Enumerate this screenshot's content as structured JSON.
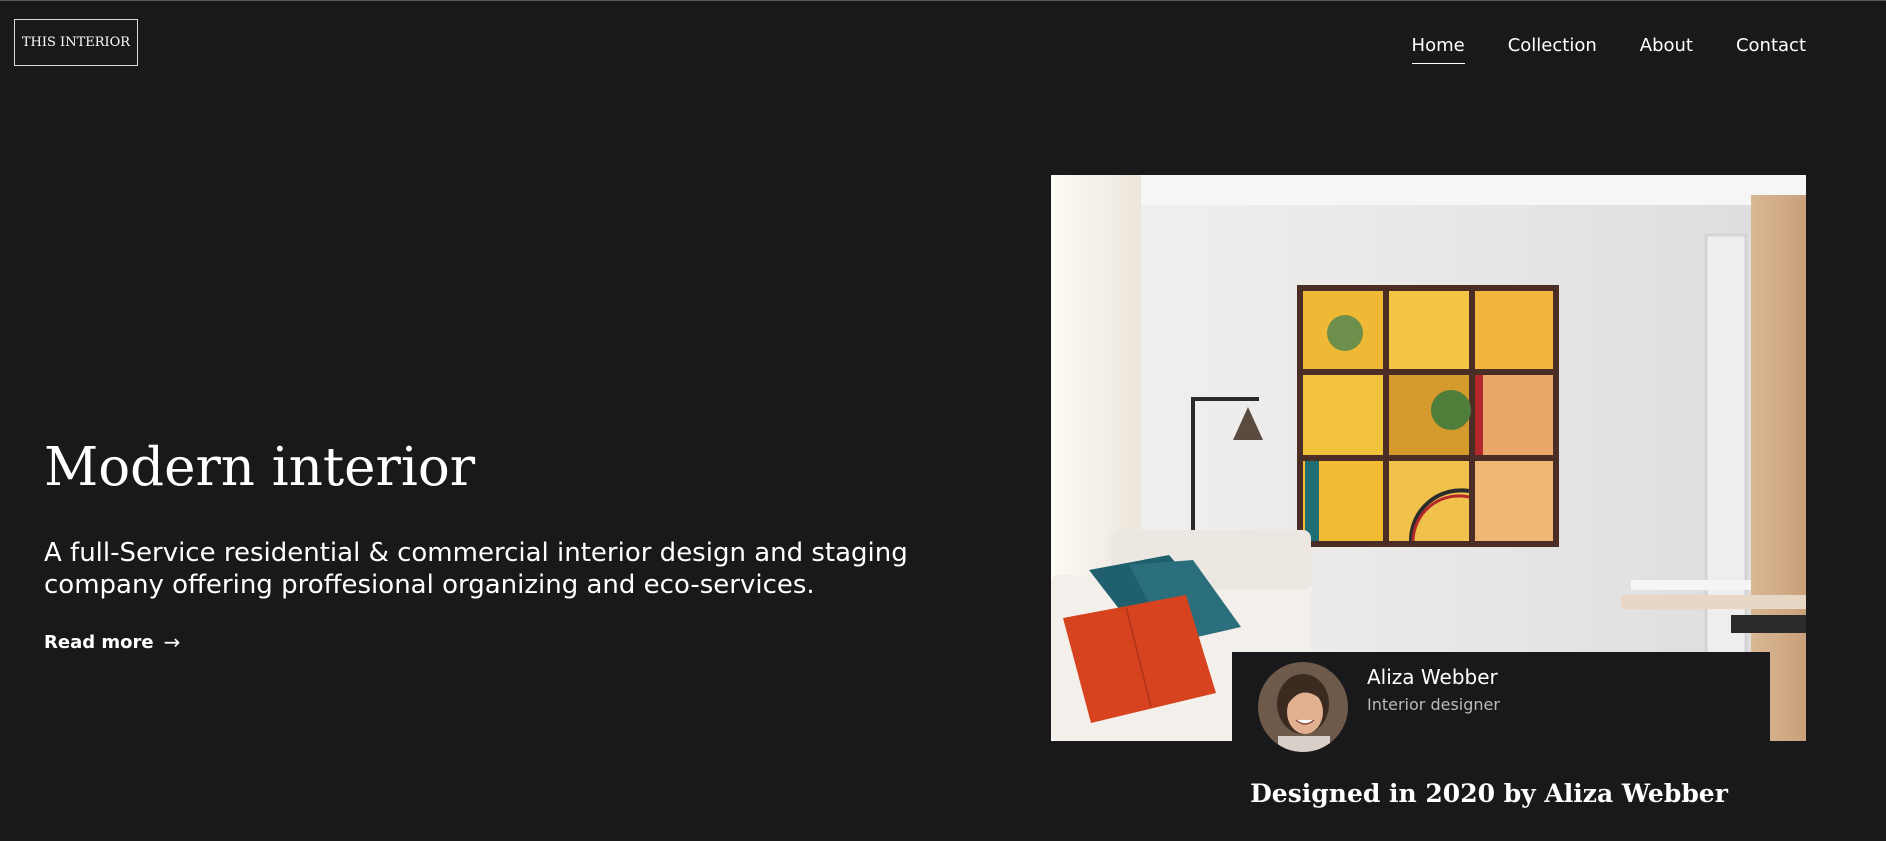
{
  "header": {
    "logo_text": "THIS INTERIOR",
    "nav": [
      {
        "label": "Home",
        "active": true
      },
      {
        "label": "Collection",
        "active": false
      },
      {
        "label": "About",
        "active": false
      },
      {
        "label": "Contact",
        "active": false
      }
    ]
  },
  "hero": {
    "title": "Modern interior",
    "description": "A full-Service residential & commercial interior design and staging company offering proffesional organizing and eco-services.",
    "read_more": "Read more",
    "read_more_icon": "arrow-right-icon",
    "read_more_arrow": "→"
  },
  "designer": {
    "name": "Aliza Webber",
    "role": "Interior designer",
    "credit": "Designed in 2020 by Aliza Webber"
  },
  "colors": {
    "background": "#19181b",
    "text": "#ffffff",
    "muted_text": "#b9b9b9"
  }
}
